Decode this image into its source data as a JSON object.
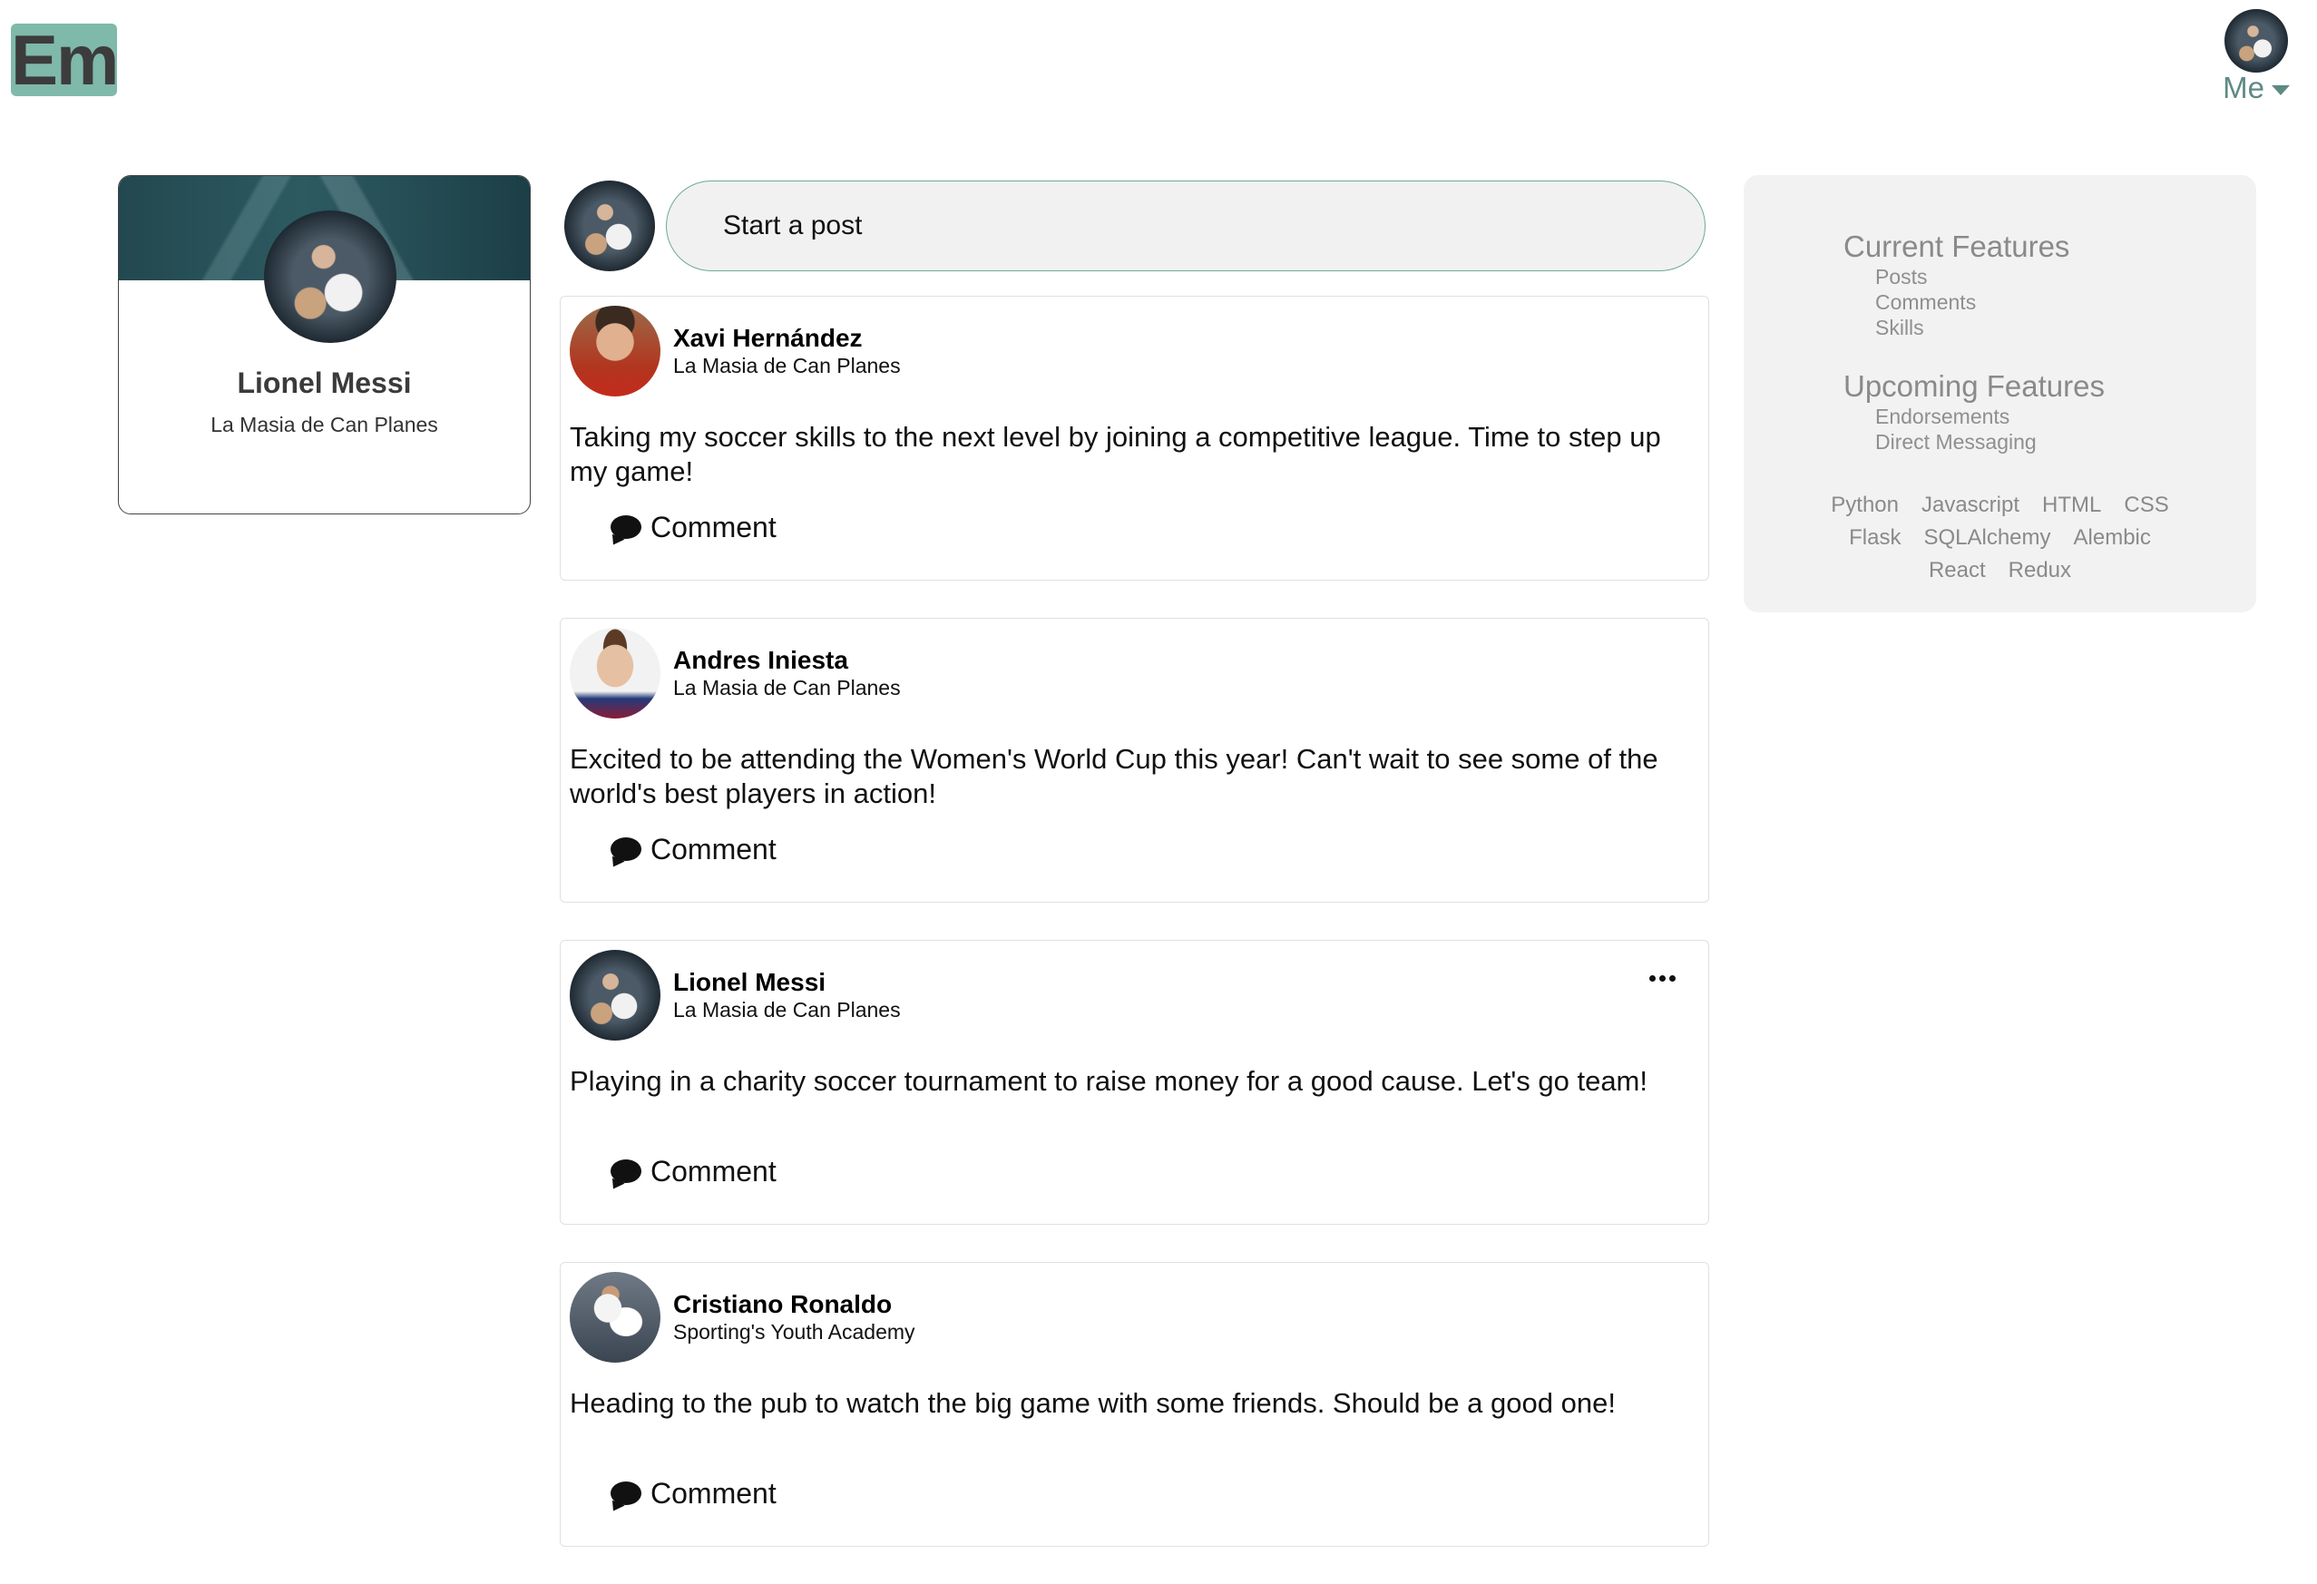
{
  "header": {
    "logo_text": "Em",
    "me_label": "Me"
  },
  "profile": {
    "name": "Lionel Messi",
    "school": "La Masia de Can Planes"
  },
  "composer": {
    "placeholder": "Start a post"
  },
  "posts": [
    {
      "author": "Xavi Hernández",
      "school": "La Masia de Can Planes",
      "body": "Taking my soccer skills to the next level by joining a competitive league. Time to step up my game!",
      "comment_label": "Comment",
      "avatar_icon": "xavi-avatar"
    },
    {
      "author": "Andres Iniesta",
      "school": "La Masia de Can Planes",
      "body": "Excited to be attending the Women's World Cup this year! Can't wait to see some of the world's best players in action!",
      "comment_label": "Comment",
      "avatar_icon": "iniesta-avatar"
    },
    {
      "author": "Lionel Messi",
      "school": "La Masia de Can Planes",
      "body": "Playing in a charity soccer tournament to raise money for a good cause. Let's go team!",
      "comment_label": "Comment",
      "avatar_icon": "messi-avatar",
      "has_menu": true
    },
    {
      "author": "Cristiano Ronaldo",
      "school": "Sporting's Youth Academy",
      "body": "Heading to the pub to watch the big game with some friends. Should be a good one!",
      "comment_label": "Comment",
      "avatar_icon": "ronaldo-avatar"
    }
  ],
  "features": {
    "current_title": "Current Features",
    "current": [
      "Posts",
      "Comments",
      "Skills"
    ],
    "upcoming_title": "Upcoming Features",
    "upcoming": [
      "Endorsements",
      "Direct Messaging"
    ],
    "skills_rows": [
      [
        "Python",
        "Javascript",
        "HTML",
        "CSS"
      ],
      [
        "Flask",
        "SQLAlchemy",
        "Alembic"
      ],
      [
        "React",
        "Redux"
      ]
    ]
  },
  "colors": {
    "accent": "#7fb9aa",
    "accent_text": "#5e8a84",
    "panel_bg": "#f2f2f2",
    "composer_bg": "#f1f1f1"
  }
}
